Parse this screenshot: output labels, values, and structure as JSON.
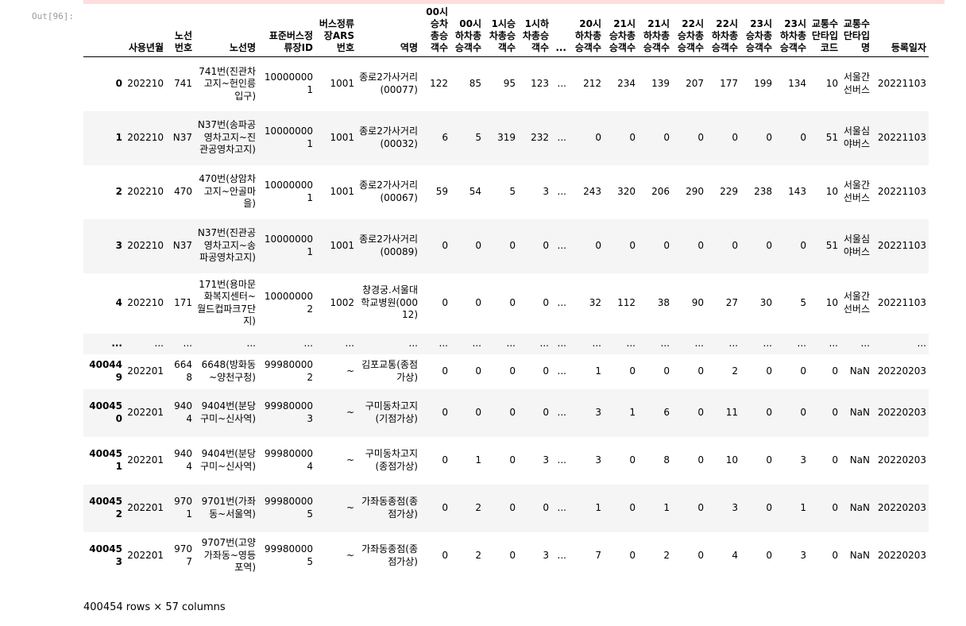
{
  "cell": {
    "prompt": "Out[96]:",
    "shape": "400454 rows × 57 columns"
  },
  "columns": [
    "",
    "사용년월",
    "노선번호",
    "노선명",
    "표준버스정류장ID",
    "버스정류장ARS번호",
    "역명",
    "00시승차총승객수",
    "00시하차총승객수",
    "1시승차총승객수",
    "1시하차총승객수",
    "...",
    "20시하차총승객수",
    "21시승차총승객수",
    "21시하차총승객수",
    "22시승차총승객수",
    "22시하차총승객수",
    "23시승차총승객수",
    "23시하차총승객수",
    "교통수단타입코드",
    "교통수단타입명",
    "등록일자"
  ],
  "rows": [
    [
      "0",
      "202210",
      "741",
      "741번(진관차고지~헌인릉입구)",
      "100000001",
      "1001",
      "종로2가사거리(00077)",
      "122",
      "85",
      "95",
      "123",
      "...",
      "212",
      "234",
      "139",
      "207",
      "177",
      "199",
      "134",
      "10",
      "서울간선버스",
      "20221103"
    ],
    [
      "1",
      "202210",
      "N37",
      "N37번(송파공영차고지~진관공영차고지)",
      "100000001",
      "1001",
      "종로2가사거리(00032)",
      "6",
      "5",
      "319",
      "232",
      "...",
      "0",
      "0",
      "0",
      "0",
      "0",
      "0",
      "0",
      "51",
      "서울심야버스",
      "20221103"
    ],
    [
      "2",
      "202210",
      "470",
      "470번(상암차고지~안골마을)",
      "100000001",
      "1001",
      "종로2가사거리(00067)",
      "59",
      "54",
      "5",
      "3",
      "...",
      "243",
      "320",
      "206",
      "290",
      "229",
      "238",
      "143",
      "10",
      "서울간선버스",
      "20221103"
    ],
    [
      "3",
      "202210",
      "N37",
      "N37번(진관공영차고지~송파공영차고지)",
      "100000001",
      "1001",
      "종로2가사거리(00089)",
      "0",
      "0",
      "0",
      "0",
      "...",
      "0",
      "0",
      "0",
      "0",
      "0",
      "0",
      "0",
      "51",
      "서울심야버스",
      "20221103"
    ],
    [
      "4",
      "202210",
      "171",
      "171번(용마문화복지센터~월드컵파크7단지)",
      "100000002",
      "1002",
      "창경궁.서울대학교병원(00012)",
      "0",
      "0",
      "0",
      "0",
      "...",
      "32",
      "112",
      "38",
      "90",
      "27",
      "30",
      "5",
      "10",
      "서울간선버스",
      "20221103"
    ],
    [
      "...",
      "...",
      "...",
      "...",
      "...",
      "...",
      "...",
      "...",
      "...",
      "...",
      "...",
      "...",
      "...",
      "...",
      "...",
      "...",
      "...",
      "...",
      "...",
      "...",
      "...",
      "..."
    ],
    [
      "400449",
      "202201",
      "6648",
      "6648(방화동~양천구청)",
      "999800002",
      "~",
      "김포교통(종점가상)",
      "0",
      "0",
      "0",
      "0",
      "...",
      "1",
      "0",
      "0",
      "0",
      "2",
      "0",
      "0",
      "0",
      "NaN",
      "20220203"
    ],
    [
      "400450",
      "202201",
      "9404",
      "9404번(분당구미~신사역)",
      "999800003",
      "~",
      "구미동차고지(기점가상)",
      "0",
      "0",
      "0",
      "0",
      "...",
      "3",
      "1",
      "6",
      "0",
      "11",
      "0",
      "0",
      "0",
      "NaN",
      "20220203"
    ],
    [
      "400451",
      "202201",
      "9404",
      "9404번(분당구미~신사역)",
      "999800004",
      "~",
      "구미동차고지(종점가상)",
      "0",
      "1",
      "0",
      "3",
      "...",
      "3",
      "0",
      "8",
      "0",
      "10",
      "0",
      "3",
      "0",
      "NaN",
      "20220203"
    ],
    [
      "400452",
      "202201",
      "9701",
      "9701번(가좌동~서울역)",
      "999800005",
      "~",
      "가좌동종점(종점가상)",
      "0",
      "2",
      "0",
      "0",
      "...",
      "1",
      "0",
      "1",
      "0",
      "3",
      "0",
      "1",
      "0",
      "NaN",
      "20220203"
    ],
    [
      "400453",
      "202201",
      "9707",
      "9707번(고양가좌동~영등포역)",
      "999800005",
      "~",
      "가좌동종점(종점가상)",
      "0",
      "2",
      "0",
      "3",
      "...",
      "7",
      "0",
      "2",
      "0",
      "4",
      "0",
      "3",
      "0",
      "NaN",
      "20220203"
    ]
  ]
}
